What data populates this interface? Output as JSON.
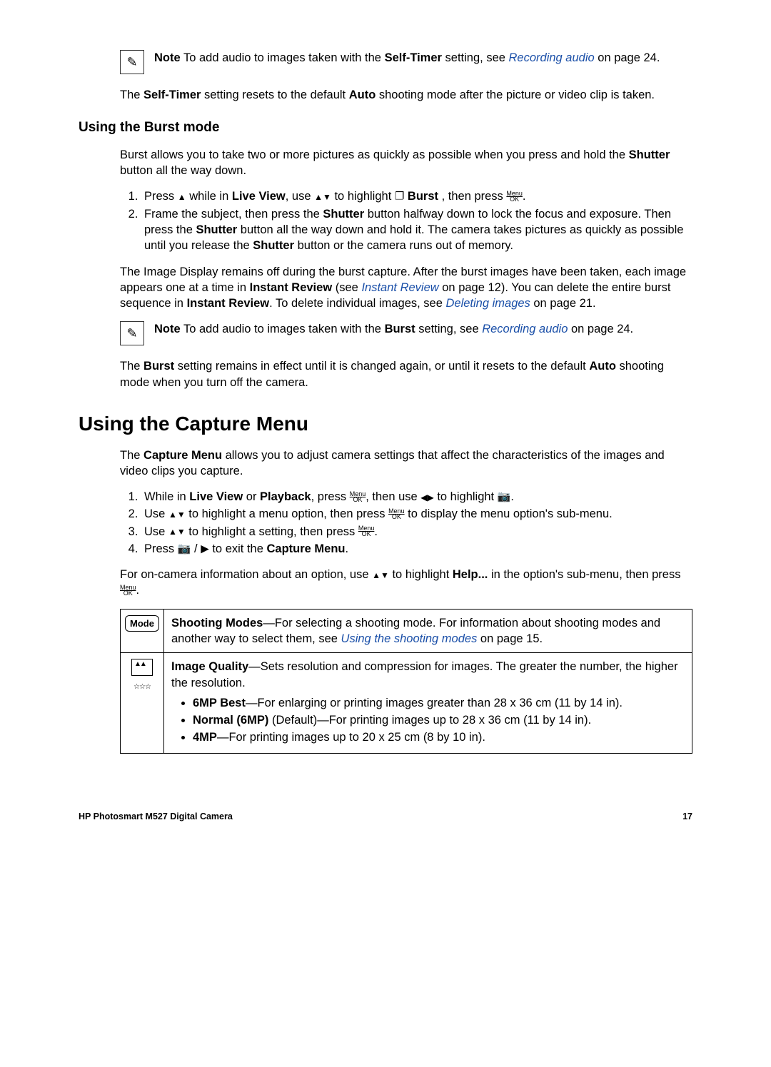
{
  "note1": {
    "label": "Note",
    "text_a": "  To add audio to images taken with the ",
    "bold_a": "Self-Timer",
    "text_b": " setting, see ",
    "link": "Recording audio",
    "text_c": " on page 24."
  },
  "para_selftimer": {
    "a": "The ",
    "b": "Self-Timer",
    "c": " setting resets to the default ",
    "d": "Auto",
    "e": " shooting mode after the picture or video clip is taken."
  },
  "h2_burst": "Using the Burst mode",
  "para_burst_intro": {
    "a": "Burst allows you to take two or more pictures as quickly as possible when you press and hold the ",
    "b": "Shutter",
    "c": " button all the way down."
  },
  "burst_steps": {
    "s1": {
      "a": "Press ",
      "b": " while in ",
      "c": "Live View",
      "d": ", use ",
      "e": " to highlight ",
      "f": " Burst",
      "g": " , then press ",
      "h": "."
    },
    "s2": {
      "a": "Frame the subject, then press the ",
      "b": "Shutter",
      "c": " button halfway down to lock the focus and exposure. Then press the ",
      "d": "Shutter",
      "e": " button all the way down and hold it. The camera takes pictures as quickly as possible until you release the ",
      "f": "Shutter",
      "g": " button or the camera runs out of memory."
    }
  },
  "para_burst_display": {
    "a": "The Image Display remains off during the burst capture. After the burst images have been taken, each image appears one at a time in ",
    "b": "Instant Review",
    "c": " (see ",
    "link1": "Instant Review",
    "d": " on page 12). You can delete the entire burst sequence in ",
    "e": "Instant Review",
    "f": ". To delete individual images, see ",
    "link2": "Deleting images",
    "g": " on page 21."
  },
  "note2": {
    "label": "Note",
    "text_a": "  To add audio to images taken with the ",
    "bold_a": "Burst",
    "text_b": " setting, see ",
    "link": "Recording audio",
    "text_c": " on page 24."
  },
  "para_burst_remain": {
    "a": "The ",
    "b": "Burst",
    "c": " setting remains in effect until it is changed again, or until it resets to the default ",
    "d": "Auto",
    "e": " shooting mode when you turn off the camera."
  },
  "h1_capture": "Using the Capture Menu",
  "para_capture_intro": {
    "a": "The ",
    "b": "Capture Menu",
    "c": " allows you to adjust camera settings that affect the characteristics of the images and video clips you capture."
  },
  "capture_steps": {
    "s1": {
      "a": "While in ",
      "b": "Live View",
      "c": " or ",
      "d": "Playback",
      "e": ", press ",
      "f": ", then use ",
      "g": " to highlight ",
      "h": "."
    },
    "s2": {
      "a": "Use ",
      "b": " to highlight a menu option, then press ",
      "c": " to display the menu option's sub-menu."
    },
    "s3": {
      "a": "Use ",
      "b": " to highlight a setting, then press ",
      "c": "."
    },
    "s4": {
      "a": "Press ",
      "b": " to exit the ",
      "c": "Capture Menu",
      "d": "."
    }
  },
  "para_oncamera": {
    "a": "For on-camera information about an option, use ",
    "b": " to highlight ",
    "c": "Help...",
    "d": " in the option's sub-menu, then press ",
    "e": "."
  },
  "table": {
    "mode_label": "Mode",
    "row1": {
      "a": "Shooting Modes",
      "b": "—For selecting a shooting mode. For information about shooting modes and another way to select them, see ",
      "link": "Using the shooting modes",
      "c": " on page 15."
    },
    "row2": {
      "a": "Image Quality",
      "b": "—Sets resolution and compression for images. The greater the number, the higher the resolution.",
      "li1": {
        "a": "6MP Best",
        "b": "—For enlarging or printing images greater than 28 x 36 cm (11 by 14 in)."
      },
      "li2": {
        "a": "Normal (6MP)",
        "b": " (Default)—For printing images up to 28 x 36 cm (11 by 14 in)."
      },
      "li3": {
        "a": "4MP",
        "b": "—For printing images up to 20 x 25 cm (8 by 10 in)."
      }
    }
  },
  "footer": {
    "left": "HP Photosmart M527 Digital Camera",
    "right": "17"
  }
}
